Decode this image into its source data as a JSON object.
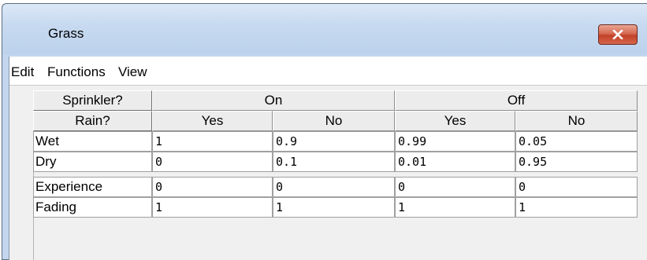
{
  "window": {
    "title": "Grass"
  },
  "menu": [
    "Edit",
    "Functions",
    "View"
  ],
  "table": {
    "sprinkler_label": "Sprinkler?",
    "rain_label": "Rain?",
    "sprinkler_values": [
      "On",
      "Off"
    ],
    "rain_values": [
      "Yes",
      "No",
      "Yes",
      "No"
    ],
    "state_rows": [
      {
        "label": "Wet",
        "values": [
          "1",
          "0.9",
          "0.99",
          "0.05"
        ]
      },
      {
        "label": "Dry",
        "values": [
          "0",
          "0.1",
          "0.01",
          "0.95"
        ]
      }
    ],
    "extra_rows": [
      {
        "label": "Experience",
        "values": [
          "0",
          "0",
          "0",
          "0"
        ]
      },
      {
        "label": "Fading",
        "values": [
          "1",
          "1",
          "1",
          "1"
        ]
      }
    ]
  },
  "colors": {
    "frame": "#c3d6ee",
    "close_button": "#c7452e",
    "header_cell": "#ececec"
  },
  "icons": {
    "close": "close-icon"
  }
}
